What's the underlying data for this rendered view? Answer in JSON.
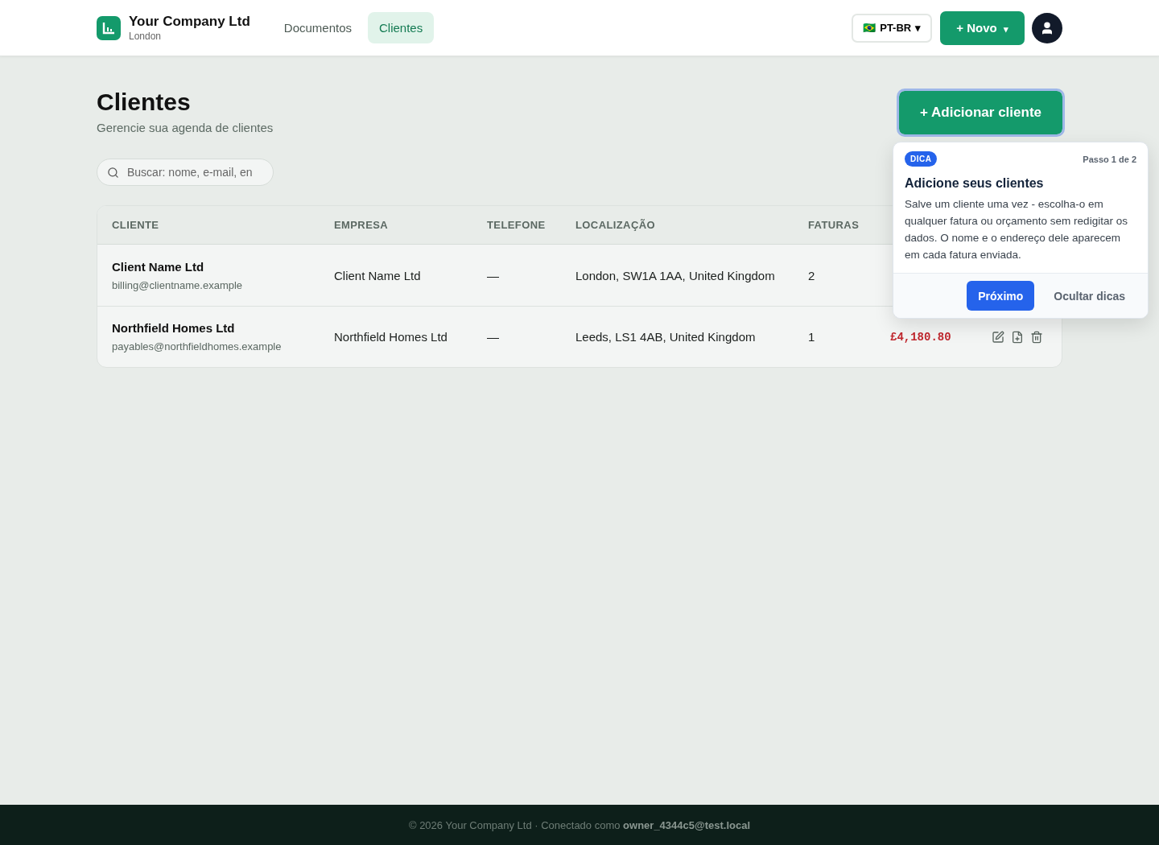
{
  "brand": {
    "name": "Your Company Ltd",
    "location": "London"
  },
  "nav": [
    {
      "label": "Documentos",
      "selected": false
    },
    {
      "label": "Clientes",
      "selected": true
    }
  ],
  "language": {
    "flag": "🇧🇷",
    "label": "PT-BR",
    "caret": "▾"
  },
  "new_button": {
    "label": "+ Novo",
    "caret": "▾"
  },
  "page": {
    "title": "Clientes",
    "subtitle": "Gerencie sua agenda de clientes",
    "add_button": "+ Adicionar cliente"
  },
  "search": {
    "placeholder": "Buscar: nome, e-mail, en"
  },
  "table": {
    "columns": [
      "CLIENTE",
      "EMPRESA",
      "TELEFONE",
      "LOCALIZAÇÃO",
      "FATURAS"
    ],
    "rows": [
      {
        "name": "Client Name Ltd",
        "email": "billing@clientname.example",
        "company": "Client Name Ltd",
        "phone": "—",
        "location": "London, SW1A 1AA, United Kingdom",
        "invoices": "2"
      },
      {
        "name": "Northfield Homes Ltd",
        "email": "payables@northfieldhomes.example",
        "company": "Northfield Homes Ltd",
        "phone": "—",
        "location": "Leeds, LS1 4AB, United Kingdom",
        "invoices": "1",
        "amount": "£4,180.80",
        "actions": true
      }
    ]
  },
  "tip": {
    "badge": "DICA",
    "step": "Passo 1 de 2",
    "title": "Adicione seus clientes",
    "body": "Salve um cliente uma vez - escolha-o em qualquer fatura ou orçamento sem redigitar os dados. O nome e o endereço dele aparecem em cada fatura enviada.",
    "next": "Próximo",
    "hide": "Ocultar dicas"
  },
  "footer": {
    "text": "© 2026 Your Company Ltd · Conectado como **owner_4344c5@test.local**"
  }
}
